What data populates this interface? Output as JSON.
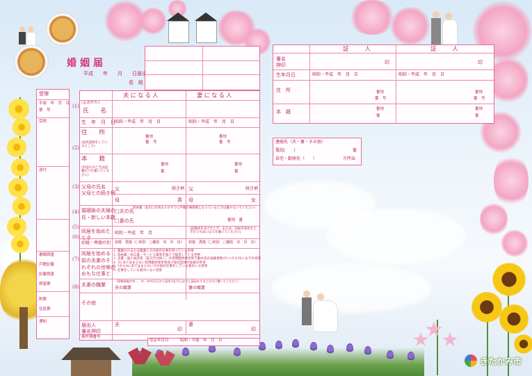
{
  "title": "婚姻届",
  "left_panel": {
    "date_line": "平成　　年　　月　　日届出",
    "addressee": "長　殿",
    "receipt_header": "受理",
    "received": "受附",
    "fields": [
      "平成　年　月　日",
      "第　号",
      "送付",
      "書類調査",
      "戸籍記載",
      "記載調査",
      "調査票",
      "附票",
      "住民票",
      "通知"
    ],
    "side_numbers": [
      "(1)",
      "(2)",
      "(3)",
      "(4)",
      "(5)",
      "(6)",
      "(7)",
      "(8)"
    ]
  },
  "main_form": {
    "header_husband": "夫になる人",
    "header_wife": "妻になる人",
    "furigana": "(よみかた)",
    "rows": [
      {
        "label": "氏　　名"
      },
      {
        "label": "生　年　月　日",
        "value_h": "昭和・平成　年　月　日",
        "value_w": "昭和・平成　年　月　日"
      },
      {
        "label": "住　　所",
        "sub": "(住民登録をしているところ)",
        "banchi": "番地",
        "go": "番　号"
      },
      {
        "label": "本　　籍",
        "sub": "(外国人のときは国籍だけを書いてください)",
        "banchi": "番地",
        "go": "番"
      },
      {
        "label": "父母の氏名\n父母との続き柄",
        "father": "父",
        "mother": "母",
        "rel": "続き柄",
        "rel2": "男",
        "rel3": "女"
      },
      {
        "label": "婚姻後の夫婦の\n氏・新しい本籍",
        "opt1": "□夫の氏",
        "opt2": "□妻の氏",
        "note": "新本籍（左の□の氏の人がすでに戸籍の筆頭者となっているときは書かないでください）",
        "banchi": "番地　番"
      },
      {
        "label": "同居を始めた\nとき",
        "value": "昭和・平成　年　月",
        "note": "(結婚式をあげたとき、または、同居を始めたときのうち早いほうを書いてください)"
      },
      {
        "label": "初婚・再婚の別",
        "value_h": "初婚　再婚（□死別　□離別　年　月　日）",
        "value_w": "初婚　再婚（□死別　□離別　年　月　日）"
      },
      {
        "label": "同居を始める\n前の夫妻のそ\nれぞれの世帯の\nおもな仕事と",
        "items": [
          "1. 農業だけまたは農業とその他の仕事を持っている世帯",
          "2. 自由業・商工業・サービス業等を個人で経営している世帯",
          "3. 企業・個人商店等（官公庁は除く）の常用勤労者世帯で勤め先の従業者数が1人から99人までの世帯",
          "4. 3にあてはまらない常用勤労者世帯及び会社団体の役員の世帯",
          "5. 1から4にあてはまらないその他の仕事をしている者のいる世帯",
          "6. 仕事をしている者のいない世帯"
        ]
      },
      {
        "label": "夫妻の職業",
        "note": "（国勢調査の年…　年…の4月1日から翌年3月31日までに届出をするときだけ書いてください）",
        "h": "夫の職業",
        "w": "妻の職業"
      },
      {
        "label": "その他"
      },
      {
        "label": "届出人\n署名押印",
        "h": "夫",
        "w": "妻",
        "seal": "印"
      },
      {
        "label": "事件簿番号",
        "note": "住定年月日",
        "value": "昭和・平成　年　月　日"
      }
    ]
  },
  "witness_form": {
    "header": "証　　人",
    "rows": [
      {
        "label": "署名\n押印",
        "seal": "印"
      },
      {
        "label": "生年月日",
        "value": "昭和・平成　年　月　日"
      },
      {
        "label": "住　所",
        "banchi": "番地",
        "go": "番　号"
      },
      {
        "label": "本　籍",
        "banchi": "番地",
        "go": "番"
      }
    ]
  },
  "contact_form": {
    "title": "連絡先（夫・妻・その他）",
    "phone": "電話(　　)",
    "phone_suffix": "番",
    "home_label": "自宅・勤務先（　　）",
    "extension": "方呼出"
  },
  "logo_text": "きたかみ市",
  "colors": {
    "accent": "#e36a9c",
    "text": "#c0306a",
    "sky": "#d9e9f7"
  }
}
